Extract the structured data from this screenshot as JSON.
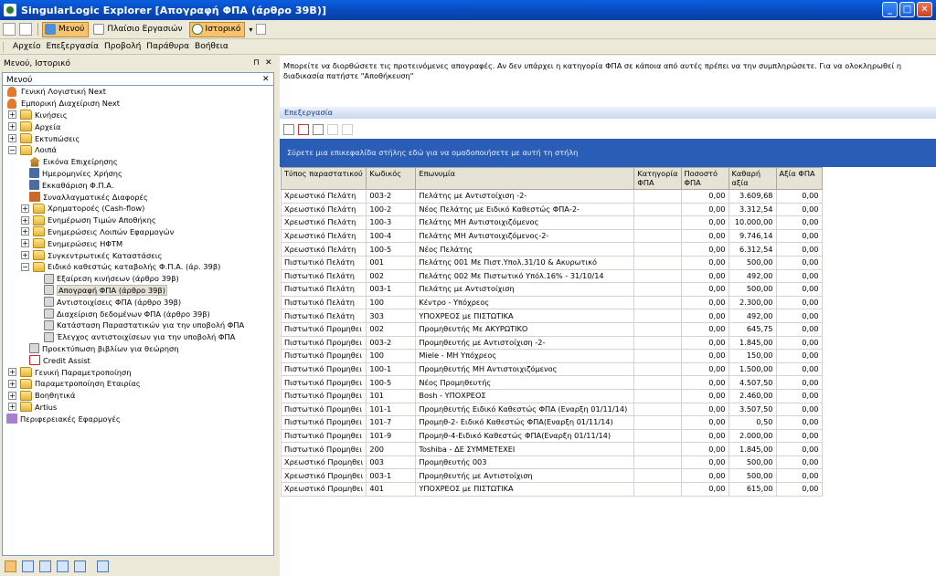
{
  "window": {
    "title": "SingularLogic Explorer [Απογραφή ΦΠΑ (άρθρο 39Β)]",
    "buttons": [
      "_",
      "□",
      "✕"
    ]
  },
  "toolbar": {
    "menu_label": "Μενού",
    "workspace_label": "Πλαίσιο Εργασιών",
    "history_label": "Ιστορικό"
  },
  "menubar": [
    "Αρχείο",
    "Επεξεργασία",
    "Προβολή",
    "Παράθυρα",
    "Βοήθεια"
  ],
  "left_panel": {
    "header": "Μενού, Ιστορικό",
    "pin": "⊓",
    "close": "✕",
    "subheader": "Μενού",
    "tree": [
      {
        "label": "Γενική Λογιστική Next",
        "icon": "user-icon",
        "level": 0,
        "expander": ""
      },
      {
        "label": "Εμπορική Διαχείριση Next",
        "icon": "user-icon",
        "level": 0,
        "expander": ""
      },
      {
        "label": "Κινήσεις",
        "icon": "folder-icon",
        "level": 1,
        "expander": "+"
      },
      {
        "label": "Αρχεία",
        "icon": "folder-icon",
        "level": 1,
        "expander": "+"
      },
      {
        "label": "Εκτυπώσεις",
        "icon": "folder-icon",
        "level": 1,
        "expander": "+"
      },
      {
        "label": "Λοιπά",
        "icon": "folder-icon",
        "level": 1,
        "expander": "−"
      },
      {
        "label": "Εικόνα Επιχείρησης",
        "icon": "home-icon",
        "level": 2,
        "expander": ""
      },
      {
        "label": "Ημερομηνίες Χρήσης",
        "icon": "calc-icon",
        "level": 2,
        "expander": ""
      },
      {
        "label": "Εκκαθάριση Φ.Π.Α.",
        "icon": "calc-icon",
        "level": 2,
        "expander": ""
      },
      {
        "label": "Συναλλαγματικές Διαφορές",
        "icon": "money-icon",
        "level": 2,
        "expander": ""
      },
      {
        "label": "Χρηματοροές (Cash-flow)",
        "icon": "folder-icon",
        "level": 2,
        "expander": "+"
      },
      {
        "label": "Ενημέρωση Τιμών Αποθήκης",
        "icon": "folder-icon",
        "level": 2,
        "expander": "+"
      },
      {
        "label": "Ενημερώσεις Λοιπών Εφαρμογών",
        "icon": "folder-icon",
        "level": 2,
        "expander": "+"
      },
      {
        "label": "Ενημερώσεις ΗΦΤΜ",
        "icon": "folder-icon",
        "level": 2,
        "expander": "+"
      },
      {
        "label": "Συγκεντρωτικές Καταστάσεις",
        "icon": "folder-icon",
        "level": 2,
        "expander": "+"
      },
      {
        "label": "Ειδικό καθεστώς καταβολής Φ.Π.Α. (άρ. 39β)",
        "icon": "folder-icon",
        "level": 2,
        "expander": "−"
      },
      {
        "label": "Εξαίρεση κινήσεων (άρθρο 39β)",
        "icon": "form-icon",
        "level": 3,
        "expander": ""
      },
      {
        "label": "Απογραφή ΦΠΑ (άρθρο 39β)",
        "icon": "form-icon",
        "level": 3,
        "expander": "",
        "selected": true
      },
      {
        "label": "Αντιστοιχίσεις ΦΠΑ (άρθρο 39β)",
        "icon": "form-icon",
        "level": 3,
        "expander": ""
      },
      {
        "label": "Διαχείριση δεδομένων ΦΠΑ (άρθρο 39β)",
        "icon": "form-icon",
        "level": 3,
        "expander": ""
      },
      {
        "label": "Κατάσταση Παραστατικών για την υποβολή ΦΠΑ",
        "icon": "form-icon",
        "level": 3,
        "expander": ""
      },
      {
        "label": "Έλεγχος αντιστοιχίσεων για την υποβολή ΦΠΑ",
        "icon": "form-icon",
        "level": 3,
        "expander": ""
      },
      {
        "label": "Προεκτύπωση βιβλίων για θεώρηση",
        "icon": "form-icon",
        "level": 2,
        "expander": ""
      },
      {
        "label": "Credit Assist",
        "icon": "ca-icon",
        "level": 2,
        "expander": ""
      },
      {
        "label": "Γενική Παραμετροποίηση",
        "icon": "folder-icon",
        "level": 1,
        "expander": "+"
      },
      {
        "label": "Παραμετροποίηση Εταιρίας",
        "icon": "folder-icon",
        "level": 1,
        "expander": "+"
      },
      {
        "label": "Βοηθητικά",
        "icon": "folder-icon",
        "level": 1,
        "expander": "+"
      },
      {
        "label": "Artius",
        "icon": "folder-icon",
        "level": 1,
        "expander": "+"
      },
      {
        "label": "Περιφερειακές Εφαρμογές",
        "icon": "peri-icon",
        "level": 0,
        "expander": ""
      }
    ]
  },
  "right_panel": {
    "instructions": "Μπορείτε να διορθώσετε τις προτεινόμενες απογραφές. Αν δεν υπάρχει η κατηγορία ΦΠΑ σε κάποια από αυτές πρέπει να την συμπληρώσετε. Για να ολοκληρωθεί η διαδικασία πατήστε \"Αποθήκευση\"",
    "edit_header": "Επεξεργασία",
    "group_hint": "Σύρετε μια επικεφαλίδα στήλης εδώ για να ομαδοποιήσετε με αυτή τη στήλη",
    "columns": [
      "Τύπος παραστατικού",
      "Κωδικός",
      "Επωνυμία",
      "Κατηγορία ΦΠΑ",
      "Ποσοστό ΦΠΑ",
      "Καθαρή αξία",
      "Αξία ΦΠΑ"
    ],
    "rows": [
      [
        "Χρεωστικό Πελάτη",
        "003-2",
        "Πελάτης με Αντιστοίχιση -2-",
        "",
        "0,00",
        "3.609,68",
        "0,00"
      ],
      [
        "Χρεωστικό Πελάτη",
        "100-2",
        "Νέος Πελάτης με Ειδικό Καθεστώς ΦΠΑ-2-",
        "",
        "0,00",
        "3.312,54",
        "0,00"
      ],
      [
        "Χρεωστικό Πελάτη",
        "100-3",
        "Πελάτης ΜΗ Αντιστοιχιζόμενος",
        "",
        "0,00",
        "10.000,00",
        "0,00"
      ],
      [
        "Χρεωστικό Πελάτη",
        "100-4",
        "Πελάτης ΜΗ Αντιστοιχιζόμενος-2-",
        "",
        "0,00",
        "9.746,14",
        "0,00"
      ],
      [
        "Χρεωστικό Πελάτη",
        "100-5",
        "Νέος Πελάτης",
        "",
        "0,00",
        "6.312,54",
        "0,00"
      ],
      [
        "Πιστωτικό Πελάτη",
        "001",
        "Πελάτης 001 Με Πιστ.Υπολ.31/10 & Ακυρωτικό",
        "",
        "0,00",
        "500,00",
        "0,00"
      ],
      [
        "Πιστωτικό Πελάτη",
        "002",
        "Πελάτης 002 Με Πιστωτικό Υπόλ.16% - 31/10/14",
        "",
        "0,00",
        "492,00",
        "0,00"
      ],
      [
        "Πιστωτικό Πελάτη",
        "003-1",
        "Πελάτης με Αντιστοίχιση",
        "",
        "0,00",
        "500,00",
        "0,00"
      ],
      [
        "Πιστωτικό Πελάτη",
        "100",
        "Κέντρο - Υπόχρεος",
        "",
        "0,00",
        "2.300,00",
        "0,00"
      ],
      [
        "Πιστωτικό Πελάτη",
        "303",
        "ΥΠΟΧΡΕΟΣ με ΠΙΣΤΩΤΙΚΑ",
        "",
        "0,00",
        "492,00",
        "0,00"
      ],
      [
        "Πιστωτικό Προμηθει",
        "002",
        "Προμηθευτής Με ΑΚΥΡΩΤΙΚΟ",
        "",
        "0,00",
        "645,75",
        "0,00"
      ],
      [
        "Πιστωτικό Προμηθει",
        "003-2",
        "Προμηθευτής με Αντιστοίχιση -2-",
        "",
        "0,00",
        "1.845,00",
        "0,00"
      ],
      [
        "Πιστωτικό Προμηθει",
        "100",
        "Miele - ΜΗ Υπόχρεος",
        "",
        "0,00",
        "150,00",
        "0,00"
      ],
      [
        "Πιστωτικό Προμηθει",
        "100-1",
        "Προμηθευτής ΜΗ Αντιστοιχιζόμενος",
        "",
        "0,00",
        "1.500,00",
        "0,00"
      ],
      [
        "Πιστωτικό Προμηθει",
        "100-5",
        "Νέος Προμηθευτής",
        "",
        "0,00",
        "4.507,50",
        "0,00"
      ],
      [
        "Πιστωτικό Προμηθει",
        "101",
        "Bosh - ΥΠΟΧΡΕΟΣ",
        "",
        "0,00",
        "2.460,00",
        "0,00"
      ],
      [
        "Πιστωτικό Προμηθει",
        "101-1",
        "Προμηθευτής Ειδικό Καθεστώς ΦΠΑ (Εναρξη 01/11/14)",
        "",
        "0,00",
        "3.507,50",
        "0,00"
      ],
      [
        "Πιστωτικό Προμηθει",
        "101-7",
        "Προμηθ-2- Ειδικό Καθεστώς ΦΠΑ(Εναρξη 01/11/14)",
        "",
        "0,00",
        "0,50",
        "0,00"
      ],
      [
        "Πιστωτικό Προμηθει",
        "101-9",
        "Προμηθ-4-Ειδικό Καθεστώς ΦΠΑ(Εναρξη 01/11/14)",
        "",
        "0,00",
        "2.000,00",
        "0,00"
      ],
      [
        "Πιστωτικό Προμηθει",
        "200",
        "Toshiba - ΔΕ ΣΥΜΜΕΤΕΧΕΙ",
        "",
        "0,00",
        "1.845,00",
        "0,00"
      ],
      [
        "Χρεωστικό Προμηθει",
        "003",
        "Προμηθευτής 003",
        "",
        "0,00",
        "500,00",
        "0,00"
      ],
      [
        "Χρεωστικό Προμηθει",
        "003-1",
        "Προμηθευτής με Αντιστοίχιση",
        "",
        "0,00",
        "500,00",
        "0,00"
      ],
      [
        "Χρεωστικό Προμηθει",
        "401",
        "ΥΠΟΧΡΕΟΣ με ΠΙΣΤΩΤΙΚΑ",
        "",
        "0,00",
        "615,00",
        "0,00"
      ]
    ]
  }
}
